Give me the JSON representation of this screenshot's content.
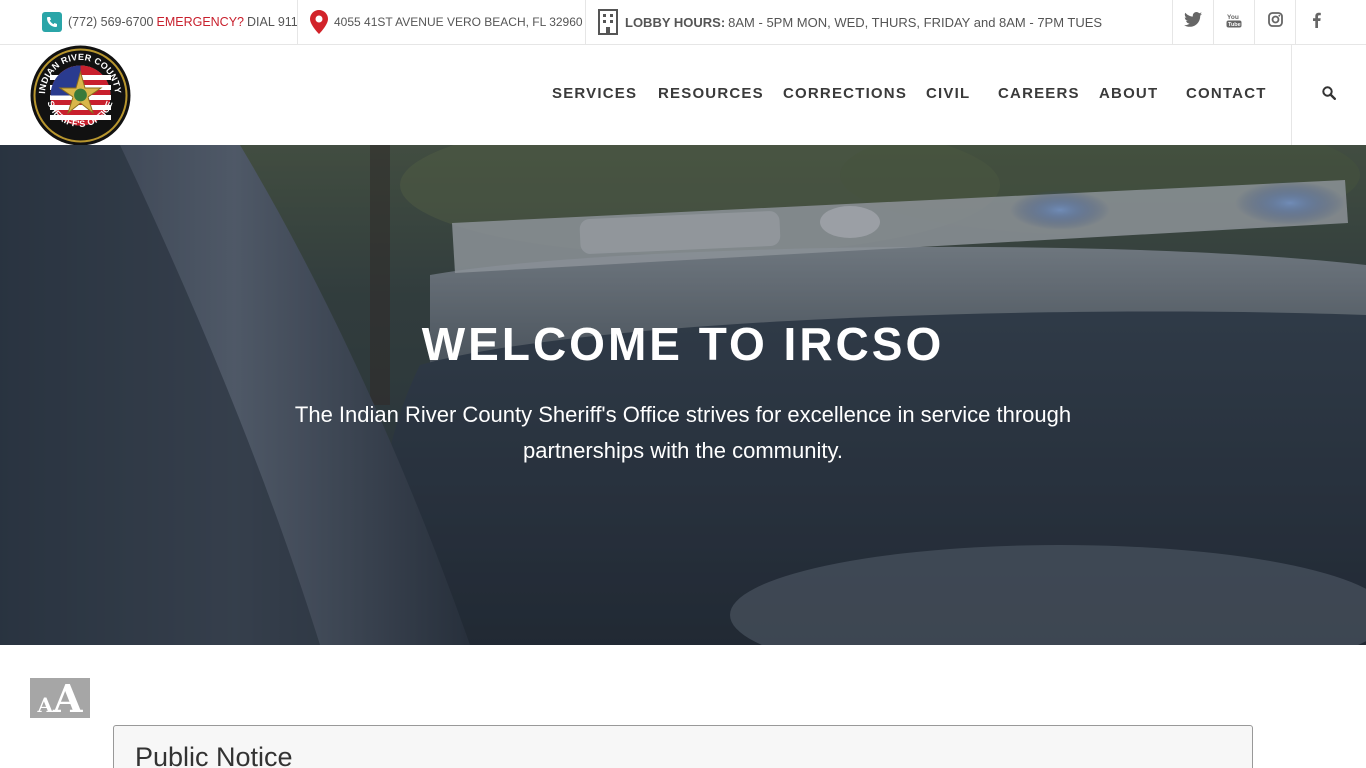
{
  "topbar": {
    "phone": "(772) 569-6700",
    "emergency_label": "EMERGENCY?",
    "emergency_text": "DIAL 911",
    "address": "4055 41ST AVENUE VERO BEACH, FL 32960",
    "lobby_label": "LOBBY HOURS:",
    "lobby_hours": "8AM - 5PM MON, WED, THURS, FRIDAY and 8AM - 7PM TUES",
    "social": [
      "twitter-icon",
      "youtube-icon",
      "instagram-icon",
      "facebook-icon"
    ]
  },
  "logo": {
    "arc_top": "INDIAN RIVER COUNTY",
    "arc_bottom": "SHERIFF'S OFFICE"
  },
  "nav": {
    "items": [
      {
        "label": "SERVICES"
      },
      {
        "label": "RESOURCES"
      },
      {
        "label": "CORRECTIONS"
      },
      {
        "label": "CIVIL"
      },
      {
        "label": "CAREERS"
      },
      {
        "label": "ABOUT"
      },
      {
        "label": "CONTACT"
      }
    ]
  },
  "hero": {
    "title": "WELCOME TO IRCSO",
    "subtitle": "The Indian River County Sheriff's Office strives for excellence in service through partnerships with the community."
  },
  "text_size_icon": {
    "small": "A",
    "large": "A"
  },
  "notice": {
    "title": "Public Notice"
  },
  "colors": {
    "accent_teal": "#2aa5a8",
    "emergency_red": "#c8202d",
    "pin_red": "#d2232a"
  }
}
